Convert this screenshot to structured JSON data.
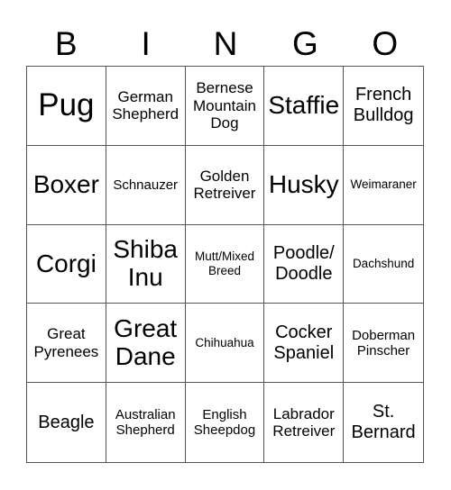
{
  "header": [
    "B",
    "I",
    "N",
    "G",
    "O"
  ],
  "cells": [
    [
      "Pug",
      "German Shepherd",
      "Bernese Mountain Dog",
      "Staffie",
      "French Bulldog"
    ],
    [
      "Boxer",
      "Schnauzer",
      "Golden Retreiver",
      "Husky",
      "Weimaraner"
    ],
    [
      "Corgi",
      "Shiba Inu",
      "Mutt/Mixed Breed",
      "Poodle/ Doodle",
      "Dachshund"
    ],
    [
      "Great Pyrenees",
      "Great Dane",
      "Chihuahua",
      "Cocker Spaniel",
      "Doberman Pinscher"
    ],
    [
      "Beagle",
      "Australian Shepherd",
      "English Sheepdog",
      "Labrador Retreiver",
      "St. Bernard"
    ]
  ]
}
